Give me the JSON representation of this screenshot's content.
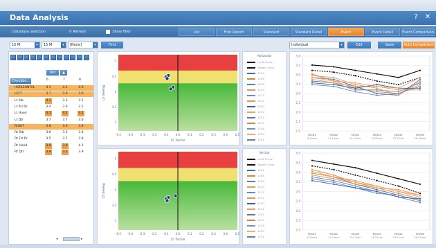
{
  "window": {
    "title": "Data Analysis",
    "help_glyph": "?",
    "close_glyph": "✕"
  },
  "toolbar": {
    "btn1": "Database selection",
    "refresh_glyph": "⟳",
    "refresh": "Refresh",
    "show_filter": "Show filter",
    "tabs": [
      "List",
      "First Report",
      "Standard",
      "Standard Detail",
      "Event",
      "Event Detail",
      "Event Comparison"
    ]
  },
  "filters": [
    "15 M",
    "15 M",
    "[None]"
  ],
  "filters_find": "Find",
  "view": {
    "mode": "Individual",
    "edit": "Edit",
    "save": "Save",
    "options": "Auto Comparison"
  },
  "table": {
    "sort_header": "Dot",
    "checkbox_header": "Checkbo...",
    "cols": [
      "6",
      "7",
      "8"
    ],
    "rows": [
      {
        "label": "HORIZONTAL",
        "v": [
          "4.3",
          "4.1",
          "4.0"
        ],
        "hl": true
      },
      {
        "label": "LEFT",
        "v": [
          "3.7",
          "3.9",
          "3.6"
        ],
        "hl": true
      },
      {
        "label": "Lt Rib",
        "v": [
          "4.1",
          "3.3",
          "3.5"
        ],
        "hl": false,
        "oc": [
          0
        ]
      },
      {
        "label": "Lt Rri Dr",
        "v": [
          "3.4",
          "3.6",
          "3.5"
        ],
        "hl": false
      },
      {
        "label": "Lt Hood",
        "v": [
          "4.1",
          "4.1",
          "4.2"
        ],
        "hl": false,
        "oc": [
          0,
          1,
          2
        ]
      },
      {
        "label": "Lt Qtr",
        "v": [
          "3.7",
          "3.7",
          "3.6"
        ],
        "hl": false
      },
      {
        "label": "RIGHT",
        "v": [
          "3.8",
          "3.9",
          "3.9"
        ],
        "hl": true
      },
      {
        "label": "Rt Rib",
        "v": [
          "3.6",
          "3.3",
          "3.4"
        ],
        "hl": false
      },
      {
        "label": "Rt Frt Dr",
        "v": [
          "3.5",
          "3.7",
          "3.8"
        ],
        "hl": false
      },
      {
        "label": "Rt Hood",
        "v": [
          "3.9",
          "3.9",
          "4.1"
        ],
        "hl": false,
        "oc": [
          0,
          1
        ]
      },
      {
        "label": "Rt Qtr",
        "v": [
          "3.9",
          "3.3",
          "3.9"
        ],
        "hl": false,
        "oc": [
          0,
          1
        ]
      }
    ]
  },
  "colors": {
    "red": "#e84040",
    "yellow": "#f0e070",
    "green": "#2ea836",
    "accent": "#e6852e"
  },
  "legend_top": {
    "title": "Horizontal",
    "items": [
      {
        "label": "Limit Curve",
        "color": "#111111"
      },
      {
        "label": "Target Curve",
        "color": "#111111"
      },
      {
        "label": "1201",
        "color": "#3f6fb5"
      },
      {
        "label": "1208",
        "color": "#e6852e"
      },
      {
        "label": "1209",
        "color": "#5a7fc0"
      },
      {
        "label": "1210",
        "color": "#e69a55"
      },
      {
        "label": "1211",
        "color": "#6b88c8"
      },
      {
        "label": "1212",
        "color": "#ef9450"
      },
      {
        "label": "1240",
        "color": "#2e5fa8"
      },
      {
        "label": "1241",
        "color": "#f0a060"
      },
      {
        "label": "1242",
        "color": "#4d76bf"
      },
      {
        "label": "1243",
        "color": "#e67d3a"
      },
      {
        "label": "1244",
        "color": "#7090c8"
      },
      {
        "label": "1250",
        "color": "#f2b070"
      },
      {
        "label": "1251",
        "color": "#5580c0"
      }
    ]
  },
  "legend_bottom": {
    "title": "Vertical",
    "items": [
      {
        "label": "Limit Curve",
        "color": "#111111"
      },
      {
        "label": "Target Curve",
        "color": "#111111"
      },
      {
        "label": "1201",
        "color": "#3f6fb5"
      },
      {
        "label": "1208",
        "color": "#e6852e"
      },
      {
        "label": "1209",
        "color": "#5a7fc0"
      },
      {
        "label": "1210",
        "color": "#e69a55"
      },
      {
        "label": "1211",
        "color": "#6b88c8"
      },
      {
        "label": "1212",
        "color": "#ef9450"
      },
      {
        "label": "1240",
        "color": "#2e5fa8"
      },
      {
        "label": "1241",
        "color": "#f0a060"
      },
      {
        "label": "1242",
        "color": "#4d76bf"
      },
      {
        "label": "1243",
        "color": "#e67d3a"
      },
      {
        "label": "1244",
        "color": "#7090c8"
      },
      {
        "label": "1250",
        "color": "#f2b070"
      },
      {
        "label": "1251",
        "color": "#5580c0"
      }
    ]
  },
  "chart_data": [
    {
      "type": "scatter",
      "id": "quadTop",
      "xlabel": "L5 Tactile",
      "ylabel": "L5 Seeing",
      "xticks": [
        "-0.5",
        "-0.4",
        "-0.3",
        "-0.2",
        "-0.1",
        "0.0",
        "0.1",
        "0.2",
        "0.3",
        "0.4",
        "0.5"
      ],
      "yticks": [
        "5",
        "4.5",
        "4",
        "3.5",
        "3"
      ],
      "xlim": [
        -0.5,
        0.5
      ],
      "ylim": [
        2.8,
        5.2
      ],
      "bands": [
        {
          "from": 4.7,
          "to": 5.2,
          "color": "#e84040"
        },
        {
          "from": 4.3,
          "to": 4.7,
          "color": "#f0e070"
        },
        {
          "from": 2.8,
          "to": 4.3,
          "color": "#2ea836"
        }
      ],
      "points": [
        {
          "x": -0.08,
          "y": 4.55
        },
        {
          "x": -0.1,
          "y": 4.5
        },
        {
          "x": -0.09,
          "y": 4.45
        },
        {
          "x": -0.04,
          "y": 4.18
        },
        {
          "x": -0.06,
          "y": 4.12
        }
      ]
    },
    {
      "type": "scatter",
      "id": "quadBot",
      "xlabel": "L5 Tactile",
      "ylabel": "L5 Seeing",
      "xticks": [
        "-0.5",
        "-0.4",
        "-0.3",
        "-0.2",
        "-0.1",
        "0.0",
        "0.1",
        "0.2",
        "0.3",
        "0.4",
        "0.5"
      ],
      "yticks": [
        "5",
        "4.5",
        "4",
        "3.5",
        "3"
      ],
      "xlim": [
        -0.5,
        0.5
      ],
      "ylim": [
        2.8,
        5.2
      ],
      "bands": [
        {
          "from": 4.7,
          "to": 5.2,
          "color": "#e84040"
        },
        {
          "from": 4.3,
          "to": 4.7,
          "color": "#f0e070"
        },
        {
          "from": 2.8,
          "to": 4.3,
          "color": "#2ea836"
        }
      ],
      "points": [
        {
          "x": -0.08,
          "y": 3.8
        },
        {
          "x": -0.1,
          "y": 3.75
        },
        {
          "x": -0.09,
          "y": 3.7
        },
        {
          "x": -0.02,
          "y": 3.85
        }
      ]
    },
    {
      "type": "line",
      "id": "lineTop",
      "categories": [
        "MOD1",
        "MOD2",
        "MOD3",
        "MOD4",
        "MOD5",
        "MOD6"
      ],
      "subcategories": [
        "6-10mm",
        "11-14mm",
        "15-17mm",
        "18-22mm",
        "23-27mm",
        "28-32mm"
      ],
      "yticks": [
        "5.0",
        "4.5",
        "4.0",
        "3.5",
        "3.0",
        "2.5",
        "2.0",
        "1.5",
        "1.0"
      ],
      "ylim": [
        1.0,
        5.2
      ],
      "series": [
        {
          "color": "#111111",
          "dash": false,
          "values": [
            4.7,
            4.6,
            4.4,
            4.2,
            4.0,
            4.4
          ]
        },
        {
          "color": "#111111",
          "dash": true,
          "values": [
            4.4,
            4.3,
            4.1,
            3.8,
            3.6,
            4.0
          ]
        },
        {
          "color": "#3f6fb5",
          "values": [
            4.0,
            3.9,
            3.5,
            3.1,
            3.0,
            3.9
          ]
        },
        {
          "color": "#e6852e",
          "values": [
            4.2,
            3.8,
            3.4,
            3.2,
            3.1,
            3.6
          ]
        },
        {
          "color": "#5a7fc0",
          "values": [
            3.8,
            3.7,
            3.3,
            3.3,
            3.2,
            3.7
          ]
        },
        {
          "color": "#e69a55",
          "values": [
            4.1,
            4.0,
            3.6,
            3.4,
            3.0,
            3.8
          ]
        },
        {
          "color": "#6b88c8",
          "values": [
            3.6,
            3.5,
            3.2,
            3.0,
            3.1,
            3.5
          ]
        },
        {
          "color": "#ef9450",
          "values": [
            3.9,
            3.7,
            3.5,
            3.5,
            3.3,
            3.3
          ]
        },
        {
          "color": "#2e5fa8",
          "values": [
            3.7,
            3.6,
            3.4,
            3.6,
            3.4,
            3.4
          ]
        },
        {
          "color": "#f0a060",
          "values": [
            4.0,
            3.8,
            3.7,
            3.5,
            3.4,
            4.0
          ]
        }
      ]
    },
    {
      "type": "line",
      "id": "lineBot",
      "categories": [
        "MOD1",
        "MOD2",
        "MOD3",
        "MOD4",
        "MOD5",
        "MOD6"
      ],
      "subcategories": [
        "6-10mm",
        "11-14mm",
        "15-17mm",
        "18-22mm",
        "23-27mm",
        "28-32mm"
      ],
      "yticks": [
        "5.0",
        "4.5",
        "4.0",
        "3.5",
        "3.0",
        "2.5",
        "2.0",
        "1.5",
        "1.0"
      ],
      "ylim": [
        1.0,
        5.2
      ],
      "series": [
        {
          "color": "#111111",
          "dash": false,
          "values": [
            4.8,
            4.6,
            4.4,
            4.1,
            3.8,
            3.5
          ]
        },
        {
          "color": "#111111",
          "dash": true,
          "values": [
            4.5,
            4.3,
            4.0,
            3.7,
            3.4,
            3.0
          ]
        },
        {
          "color": "#3f6fb5",
          "values": [
            4.1,
            3.9,
            3.5,
            3.2,
            2.9,
            2.6
          ]
        },
        {
          "color": "#e6852e",
          "values": [
            4.3,
            4.0,
            3.6,
            3.3,
            3.0,
            2.7
          ]
        },
        {
          "color": "#5a7fc0",
          "values": [
            3.9,
            3.7,
            3.4,
            3.1,
            2.8,
            2.5
          ]
        },
        {
          "color": "#e69a55",
          "values": [
            4.2,
            3.9,
            3.7,
            3.4,
            3.1,
            2.8
          ]
        },
        {
          "color": "#6b88c8",
          "values": [
            3.8,
            3.6,
            3.3,
            3.0,
            2.9,
            2.6
          ]
        },
        {
          "color": "#ef9450",
          "values": [
            4.0,
            3.8,
            3.5,
            3.3,
            3.2,
            2.9
          ]
        },
        {
          "color": "#2e5fa8",
          "values": [
            3.7,
            3.5,
            3.3,
            3.1,
            2.8,
            2.7
          ]
        },
        {
          "color": "#f0a060",
          "values": [
            4.1,
            3.9,
            3.6,
            3.4,
            3.1,
            2.9
          ]
        }
      ]
    }
  ]
}
